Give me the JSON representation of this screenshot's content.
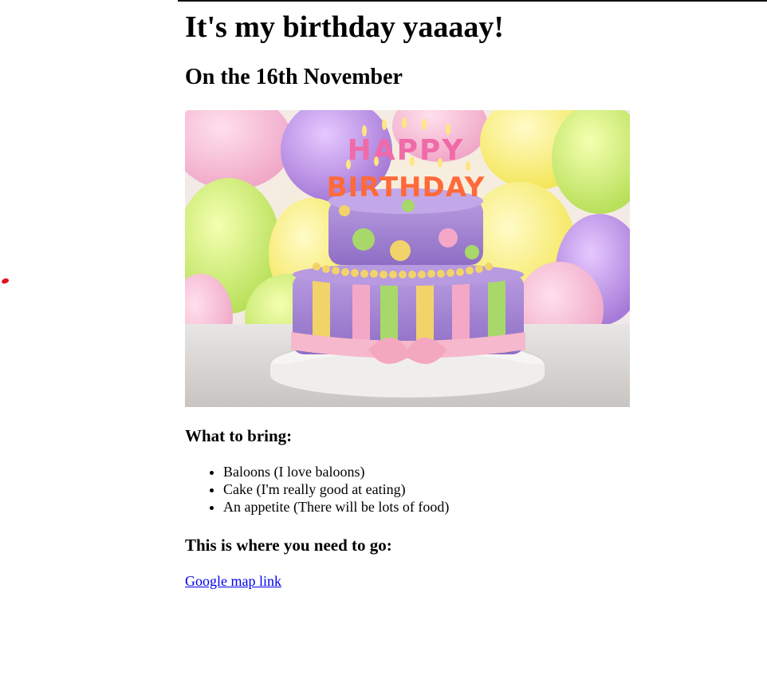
{
  "page": {
    "heading": "It's my birthday yaaaay!",
    "date_heading": "On the 16th November",
    "image": {
      "alt": "Birthday cake",
      "cake_letters_top": "HAPPY",
      "cake_letters_bottom": "BIRTHDAY"
    },
    "bring_heading": "What to bring:",
    "bring_items": [
      "Baloons (I love baloons)",
      "Cake (I'm really good at eating)",
      "An appetite (There will be lots of food)"
    ],
    "where_heading": "This is where you need to go:",
    "map_link": "Google map link"
  },
  "colors": {
    "link": "#0000ee",
    "text": "#000000",
    "red_mark": "#e0141e"
  }
}
